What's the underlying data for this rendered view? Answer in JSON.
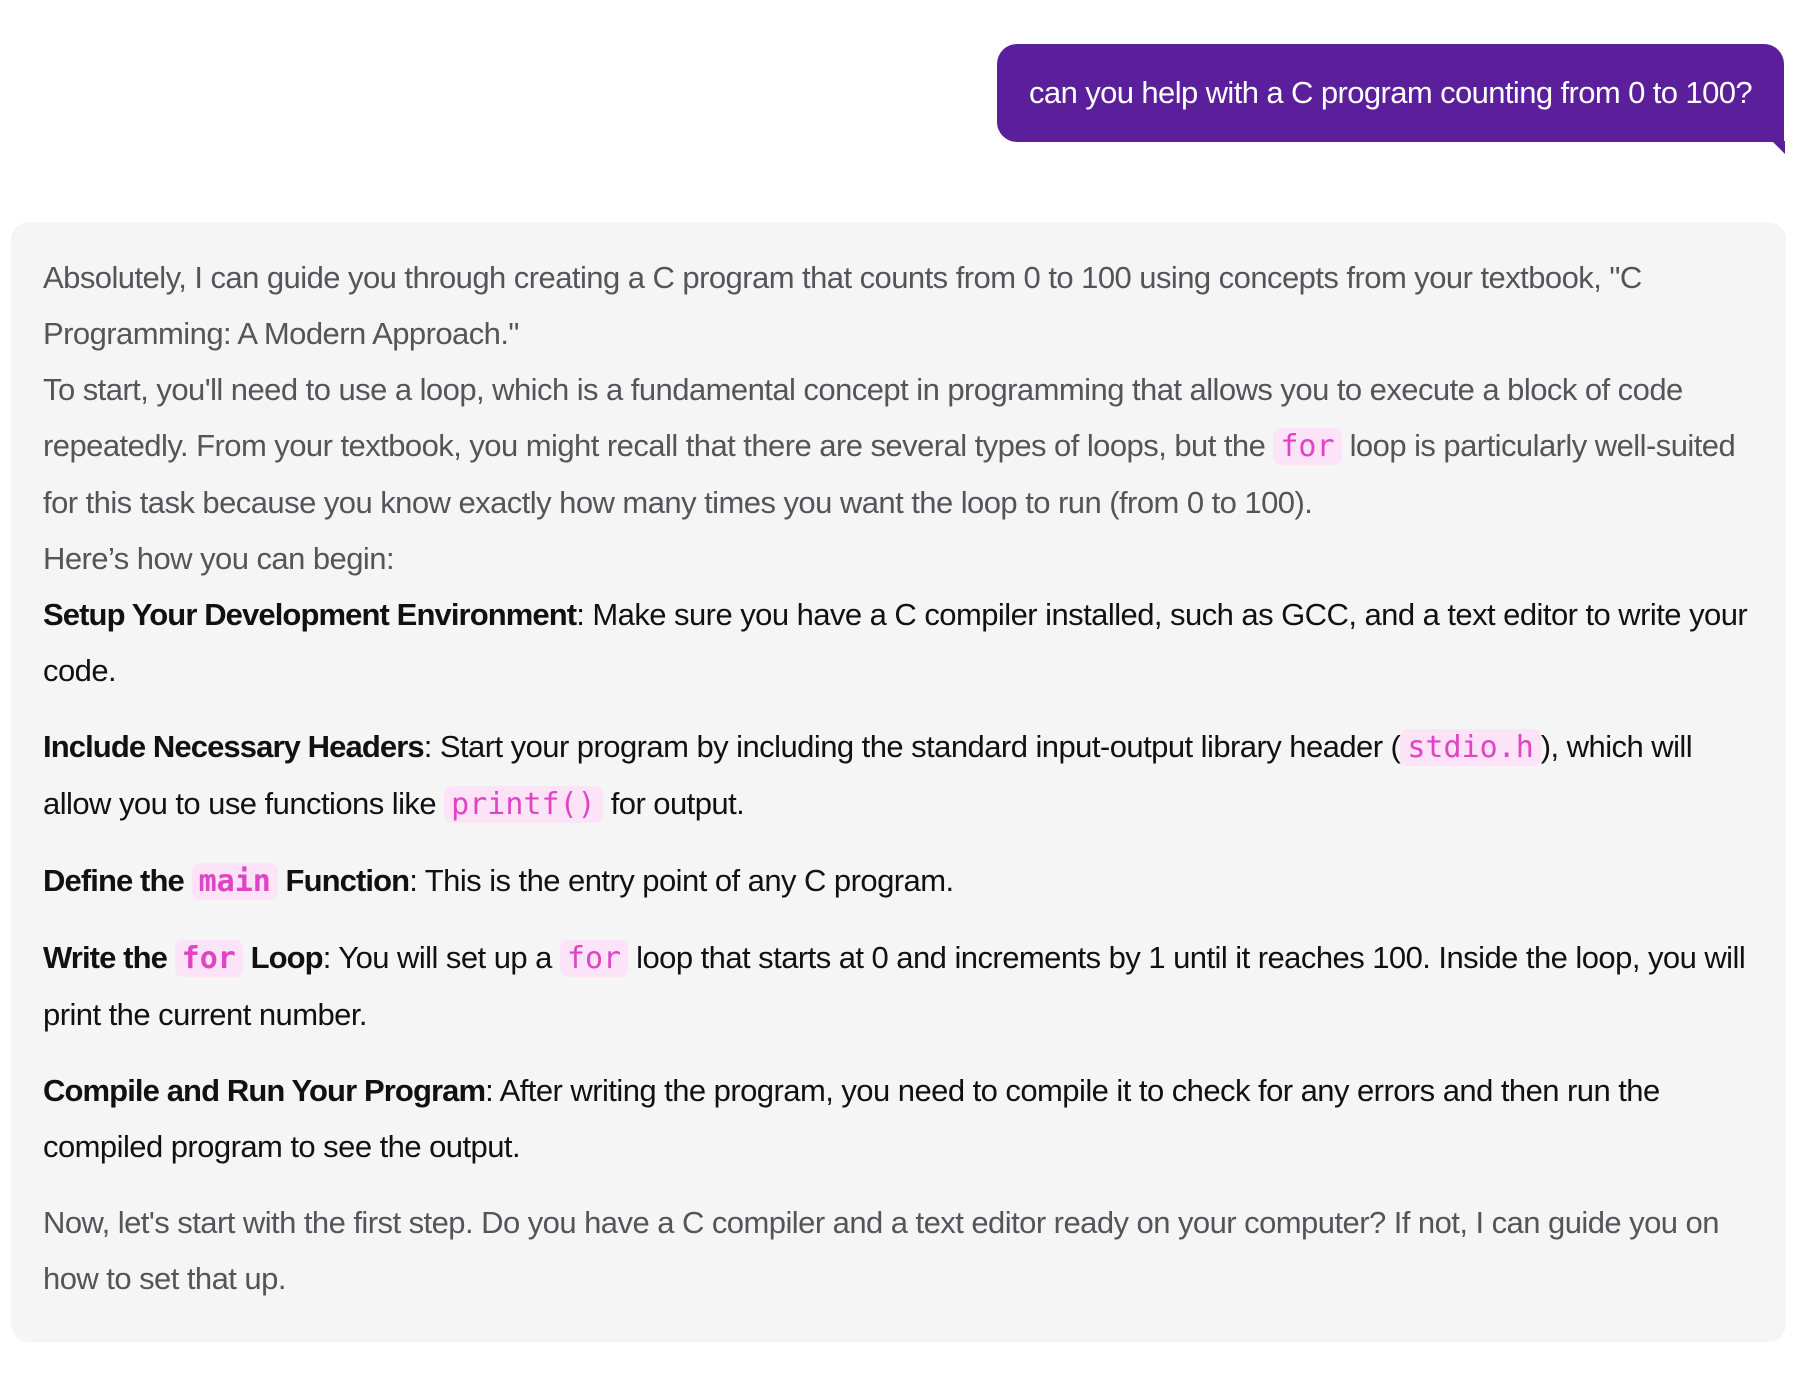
{
  "user_message": {
    "text": "can you help with a C program counting from 0 to 100?"
  },
  "assistant": {
    "intro": "Absolutely, I can guide you through creating a C program that counts from 0 to 100 using concepts from your textbook, \"C Programming: A Modern Approach.\"",
    "loop_para": {
      "before_code": "To start, you'll need to use a loop, which is a fundamental concept in programming that allows you to execute a block of code repeatedly. From your textbook, you might recall that there are several types of loops, but the ",
      "code": "for",
      "after_code": " loop is particularly well-suited for this task because you know exactly how many times you want the loop to run (from 0 to 100)."
    },
    "begin_line": "Here’s how you can begin:",
    "steps": {
      "setup": {
        "title": "Setup Your Development Environment",
        "text": ": Make sure you have a C compiler installed, such as GCC, and a text editor to write your code."
      },
      "headers": {
        "title": "Include Necessary Headers",
        "text_1": ": Start your program by including the standard input-output library header (",
        "code_1": "stdio.h",
        "text_2": "), which will allow you to use functions like ",
        "code_2": "printf()",
        "text_3": " for output."
      },
      "main": {
        "title_1": "Define the ",
        "code": "main",
        "title_2": " Function",
        "text": ": This is the entry point of any C program."
      },
      "loop": {
        "title_1": "Write the ",
        "code_title": "for",
        "title_2": " Loop",
        "text_1": ": You will set up a ",
        "code": "for",
        "text_2": " loop that starts at 0 and increments by 1 until it reaches 100. Inside the loop, you will print the current number."
      },
      "compile": {
        "title": "Compile and Run Your Program",
        "text": ": After writing the program, you need to compile it to check for any errors and then run the compiled program to see the output."
      }
    },
    "closing": "Now, let's start with the first step. Do you have a C compiler and a text editor ready on your computer? If not, I can guide you on how to set that up."
  },
  "colors": {
    "user_bubble": "#5b1f9b",
    "card_background": "#f5f5f5",
    "code_text": "#e044c4",
    "code_background": "#fce3f7"
  }
}
